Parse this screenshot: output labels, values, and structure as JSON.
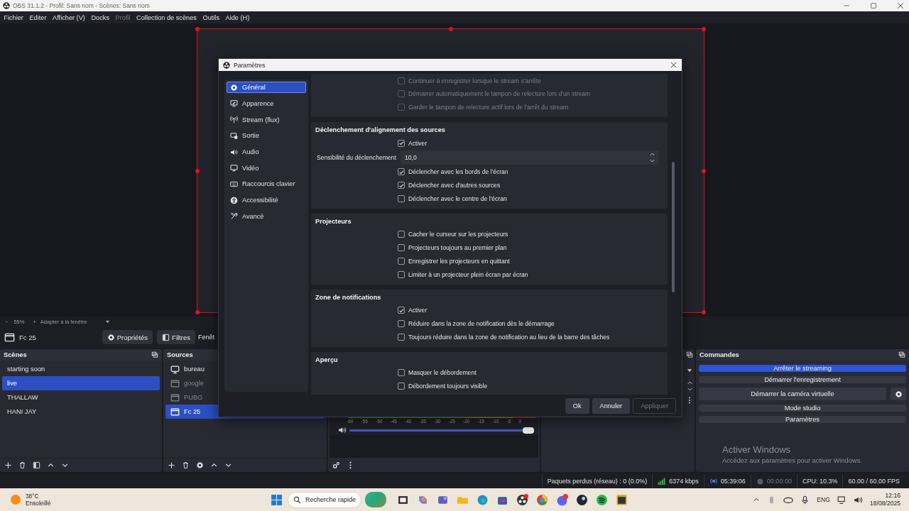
{
  "window": {
    "title": "OBS 31.1.2 - Profil: Sans nom - Scènes: Sans nom"
  },
  "menu": [
    {
      "label": "Fichier",
      "disabled": false
    },
    {
      "label": "Editer",
      "disabled": false
    },
    {
      "label": "Afficher (V)",
      "disabled": false
    },
    {
      "label": "Docks",
      "disabled": false
    },
    {
      "label": "Profil",
      "disabled": true
    },
    {
      "label": "Collection de scènes",
      "disabled": false
    },
    {
      "label": "Outils",
      "disabled": false
    },
    {
      "label": "Aide (H)",
      "disabled": false
    }
  ],
  "preview": {
    "zoom_out": "−",
    "zoom": "55%",
    "zoom_in": "+",
    "fit": "Adapter à la fenêtre"
  },
  "source_toolbar": {
    "source": "Fc 25",
    "buttons": [
      "Propriétés",
      "Filtres",
      "Fenêt"
    ]
  },
  "scenes": {
    "title": "Scènes",
    "items": [
      {
        "label": "starting soon",
        "selected": false
      },
      {
        "label": "live",
        "selected": true
      },
      {
        "label": "THALLAW",
        "selected": false
      },
      {
        "label": "HANI JAY",
        "selected": false
      }
    ]
  },
  "sources": {
    "title": "Sources",
    "items": [
      {
        "label": "bureau",
        "kind": "display",
        "visible": true,
        "selected": false
      },
      {
        "label": "google",
        "kind": "window",
        "visible": false,
        "selected": false
      },
      {
        "label": "PUBG",
        "kind": "window",
        "visible": false,
        "selected": false
      },
      {
        "label": "Fc 25",
        "kind": "window",
        "visible": true,
        "selected": true
      }
    ]
  },
  "audio_mixer": {
    "ticks": [
      "-60",
      "-55",
      "-50",
      "-45",
      "-40",
      "-35",
      "-30",
      "-25",
      "-20",
      "-15",
      "-10",
      "-5",
      "0"
    ],
    "volume": {
      "level": 1
    }
  },
  "controls": {
    "title": "Commandes",
    "buttons": [
      {
        "label": "Arrêter le streaming",
        "active": true
      },
      {
        "label": "Démarrer l'enregistrement",
        "active": false
      },
      {
        "label": "Démarrer la caméra virtuelle",
        "active": false
      },
      {
        "label": "Mode studio",
        "active": false
      },
      {
        "label": "Paramètres",
        "active": false
      }
    ]
  },
  "activation_notice": {
    "title": "Activer Windows",
    "text": "Accédez aux paramètres pour activer Windows."
  },
  "status_bar": {
    "dropped": "Paquets perdus (réseau) : 0 (0.0%)",
    "bitrate": "6374 kbps",
    "stream_time": "05:39:06",
    "record_time": "00:00:00",
    "cpu": "CPU: 10.3%",
    "fps": "60.00 / 60.00 FPS"
  },
  "settings": {
    "title": "Paramètres",
    "sidebar": [
      {
        "label": "Général",
        "selected": true
      },
      {
        "label": "Apparence",
        "selected": false
      },
      {
        "label": "Stream (flux)",
        "selected": false
      },
      {
        "label": "Sortie",
        "selected": false
      },
      {
        "label": "Audio",
        "selected": false
      },
      {
        "label": "Vidéo",
        "selected": false
      },
      {
        "label": "Raccourcis clavier",
        "selected": false
      },
      {
        "label": "Accessibilité",
        "selected": false
      },
      {
        "label": "Avancé",
        "selected": false
      }
    ],
    "sections": [
      {
        "rows": [
          {
            "kind": "checkbox",
            "label": "Continuer à enregistrer lorsque le stream s'arrête",
            "checked": false,
            "disabled": true
          },
          {
            "kind": "checkbox",
            "label": "Démarrer automatiquement le tampon de relecture lors d'un stream",
            "checked": false,
            "disabled": true
          },
          {
            "kind": "checkbox",
            "label": "Garder le tampon de relecture actif lors de l'arrêt du stream",
            "checked": false,
            "disabled": true
          }
        ]
      },
      {
        "title": "Déclenchement d'alignement des sources",
        "rows": [
          {
            "kind": "checkbox",
            "label": "Activer",
            "checked": true,
            "disabled": false
          },
          {
            "kind": "spinbox",
            "label": "Sensibilité du déclenchement",
            "value": "10,0"
          },
          {
            "kind": "checkbox",
            "label": "Déclencher avec les bords de l'écran",
            "checked": true,
            "disabled": false
          },
          {
            "kind": "checkbox",
            "label": "Déclencher avec d'autres sources",
            "checked": true,
            "disabled": false
          },
          {
            "kind": "checkbox",
            "label": "Déclencher avec le centre de l'écran",
            "checked": false,
            "disabled": false
          }
        ]
      },
      {
        "title": "Projecteurs",
        "rows": [
          {
            "kind": "checkbox",
            "label": "Cacher le curseur sur les projecteurs",
            "checked": false,
            "disabled": false
          },
          {
            "kind": "checkbox",
            "label": "Projecteurs toujours au premier plan",
            "checked": false,
            "disabled": false
          },
          {
            "kind": "checkbox",
            "label": "Enregistrer les projecteurs en quittant",
            "checked": false,
            "disabled": false
          },
          {
            "kind": "checkbox",
            "label": "Limiter à un projecteur plein écran par écran",
            "checked": false,
            "disabled": false
          }
        ]
      },
      {
        "title": "Zone de notifications",
        "rows": [
          {
            "kind": "checkbox",
            "label": "Activer",
            "checked": true,
            "disabled": false
          },
          {
            "kind": "checkbox",
            "label": "Réduire dans la zone de notification dès le démarrage",
            "checked": false,
            "disabled": false
          },
          {
            "kind": "checkbox",
            "label": "Toujours réduire dans la zone de notification au lieu de la barre des tâches",
            "checked": false,
            "disabled": false
          }
        ]
      },
      {
        "title": "Aperçu",
        "rows": [
          {
            "kind": "checkbox",
            "label": "Masquer le débordement",
            "checked": false,
            "disabled": false
          },
          {
            "kind": "checkbox",
            "label": "Débordement toujours visible",
            "checked": false,
            "disabled": false
          }
        ]
      }
    ],
    "buttons": [
      {
        "label": "Ok",
        "disabled": false
      },
      {
        "label": "Annuler",
        "disabled": false
      },
      {
        "label": "Appliquer",
        "disabled": true
      }
    ]
  },
  "taskbar": {
    "temperature": "38°C",
    "weather": "Ensoleillé",
    "search": {
      "placeholder": "Recherche rapide"
    },
    "language": "ENG",
    "time": "12:16",
    "date": "18/08/2025"
  }
}
